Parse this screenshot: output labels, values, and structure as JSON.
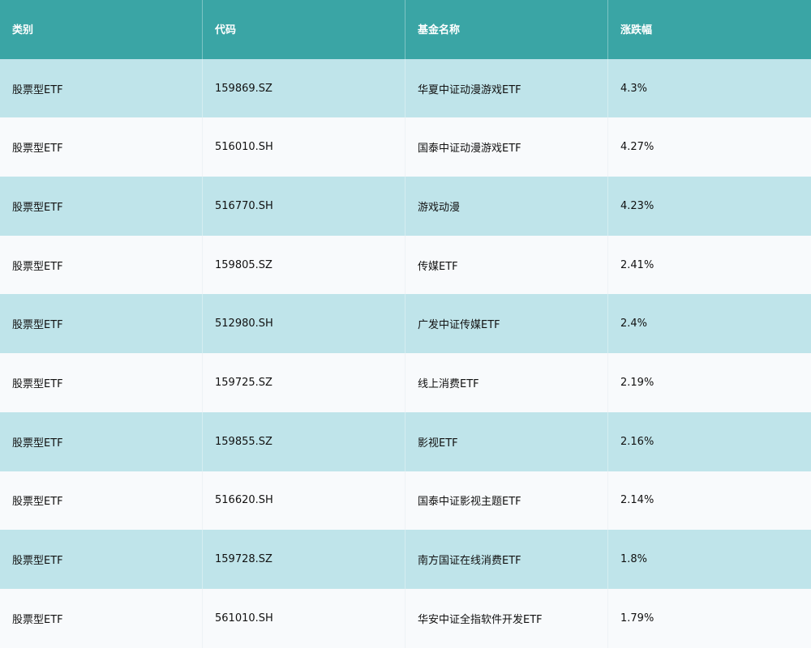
{
  "colors": {
    "header_bg": "#3aa5a5",
    "row_odd_bg": "#bfe4ea",
    "row_even_bg": "#f8fafc",
    "header_text": "#ffffff",
    "body_text": "#111111"
  },
  "chart_data": {
    "type": "table",
    "columns": [
      "类别",
      "代码",
      "基金名称",
      "涨跌幅"
    ],
    "rows": [
      [
        "股票型ETF",
        "159869.SZ",
        "华夏中证动漫游戏ETF",
        "4.3%"
      ],
      [
        "股票型ETF",
        "516010.SH",
        "国泰中证动漫游戏ETF",
        "4.27%"
      ],
      [
        "股票型ETF",
        "516770.SH",
        "游戏动漫",
        "4.23%"
      ],
      [
        "股票型ETF",
        "159805.SZ",
        "传媒ETF",
        "2.41%"
      ],
      [
        "股票型ETF",
        "512980.SH",
        "广发中证传媒ETF",
        "2.4%"
      ],
      [
        "股票型ETF",
        "159725.SZ",
        "线上消费ETF",
        "2.19%"
      ],
      [
        "股票型ETF",
        "159855.SZ",
        "影视ETF",
        "2.16%"
      ],
      [
        "股票型ETF",
        "516620.SH",
        "国泰中证影视主题ETF",
        "2.14%"
      ],
      [
        "股票型ETF",
        "159728.SZ",
        "南方国证在线消费ETF",
        "1.8%"
      ],
      [
        "股票型ETF",
        "561010.SH",
        "华安中证全指软件开发ETF",
        "1.79%"
      ]
    ]
  }
}
